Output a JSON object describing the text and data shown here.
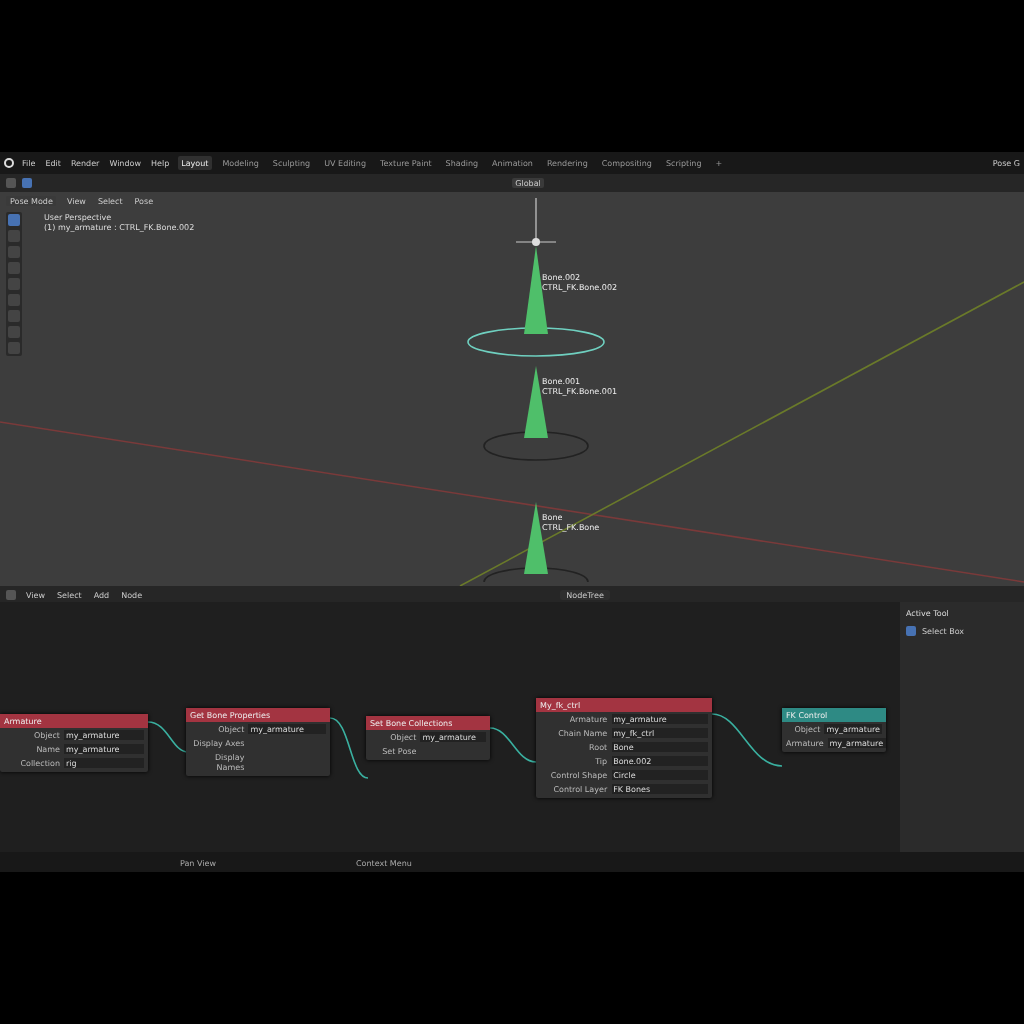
{
  "menu": [
    "File",
    "Edit",
    "Render",
    "Window",
    "Help"
  ],
  "workspaces": [
    {
      "label": "Layout",
      "selected": true
    },
    {
      "label": "Modeling",
      "selected": false
    },
    {
      "label": "Sculpting",
      "selected": false
    },
    {
      "label": "UV Editing",
      "selected": false
    },
    {
      "label": "Texture Paint",
      "selected": false
    },
    {
      "label": "Shading",
      "selected": false
    },
    {
      "label": "Animation",
      "selected": false
    },
    {
      "label": "Rendering",
      "selected": false
    },
    {
      "label": "Compositing",
      "selected": false
    },
    {
      "label": "Scripting",
      "selected": false
    }
  ],
  "add_workspace": "+",
  "scene_label": "Pose G",
  "viewport": {
    "transform": "Global",
    "mode": "Pose Mode",
    "menus": [
      "View",
      "Select",
      "Pose"
    ],
    "title": "User Perspective",
    "subtitle": "(1) my_armature : CTRL_FK.Bone.002",
    "bones": [
      {
        "name": "Bone.002",
        "control": "CTRL_FK.Bone.002",
        "selected": true
      },
      {
        "name": "Bone.001",
        "control": "CTRL_FK.Bone.001",
        "selected": false
      },
      {
        "name": "Bone",
        "control": "CTRL_FK.Bone",
        "selected": false
      }
    ]
  },
  "node_editor": {
    "menus": [
      "View",
      "Select",
      "Add",
      "Node"
    ],
    "tree": "NodeTree",
    "nodes": [
      {
        "title": "Armature",
        "kind": "red",
        "rows": [
          {
            "label": "Object",
            "value": "my_armature"
          },
          {
            "label": "Name",
            "value": "my_armature"
          },
          {
            "label": "Collection",
            "value": "rig"
          }
        ]
      },
      {
        "title": "Get Bone Properties",
        "kind": "red",
        "rows": [
          {
            "label": "Object",
            "value": "my_armature"
          },
          {
            "label": "Display Axes",
            "value": ""
          },
          {
            "label": "Display Names",
            "value": ""
          }
        ]
      },
      {
        "title": "Set Bone Collections",
        "kind": "red",
        "rows": [
          {
            "label": "Object",
            "value": "my_armature"
          },
          {
            "label": "Set Pose",
            "value": ""
          }
        ]
      },
      {
        "title": "My_fk_ctrl",
        "kind": "red",
        "rows": [
          {
            "label": "Armature",
            "value": "my_armature"
          },
          {
            "label": "Chain Name",
            "value": "my_fk_ctrl"
          },
          {
            "label": "Root",
            "value": "Bone"
          },
          {
            "label": "Tip",
            "value": "Bone.002"
          },
          {
            "label": "Control Shape",
            "value": "Circle"
          },
          {
            "label": "Control Layer",
            "value": "FK Bones"
          }
        ]
      },
      {
        "title": "FK Control",
        "kind": "teal",
        "rows": [
          {
            "label": "Object",
            "value": "my_armature"
          },
          {
            "label": "Armature",
            "value": "my_armature"
          }
        ]
      }
    ]
  },
  "sidebar": {
    "title": "Active Tool",
    "tool": "Select Box"
  },
  "status_bar": [
    "Pan View",
    "Context Menu"
  ]
}
